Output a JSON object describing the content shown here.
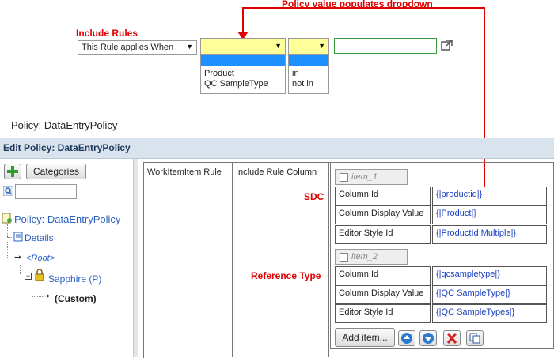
{
  "callouts": {
    "policy_value": "Policy value populates dropdown",
    "include_rules": "Include Rules",
    "sdc": "SDC",
    "reference_type": "Reference Type"
  },
  "rule_row": {
    "applies_select": "This Rule applies When",
    "dropdown1_options": [
      "Product",
      "QC SampleType"
    ],
    "dropdown2_options": [
      "in",
      "not in"
    ]
  },
  "policy_label": "Policy: DataEntryPolicy",
  "edit_header": "Edit Policy: DataEntryPolicy",
  "left": {
    "categories_button": "Categories",
    "tree": {
      "root_policy": "Policy: DataEntryPolicy",
      "details": "Details",
      "root": "<Root>",
      "sapphire": "Sapphire (P)",
      "custom": "(Custom)"
    }
  },
  "grid": {
    "col1": "WorkItemItem Rule",
    "col2": "Include Rule Column",
    "items": [
      {
        "label": "item_1",
        "rows": [
          {
            "name": "Column Id",
            "value": "{|productid|}"
          },
          {
            "name": "Column Display Value",
            "value": "{|Product|}"
          },
          {
            "name": "Editor Style Id",
            "value": "{|ProductId Multiple|}"
          }
        ]
      },
      {
        "label": "item_2",
        "rows": [
          {
            "name": "Column Id",
            "value": "{|qcsampletype|}"
          },
          {
            "name": "Column Display Value",
            "value": "{|QC SampleType|}"
          },
          {
            "name": "Editor Style Id",
            "value": "{|QC SampleTypes|}"
          }
        ]
      }
    ],
    "add_item": "Add item..."
  },
  "colors": {
    "callout": "#e00000",
    "header_bg": "#d9e3ee",
    "link": "#2a60c0",
    "value": "#1a3fc0"
  }
}
